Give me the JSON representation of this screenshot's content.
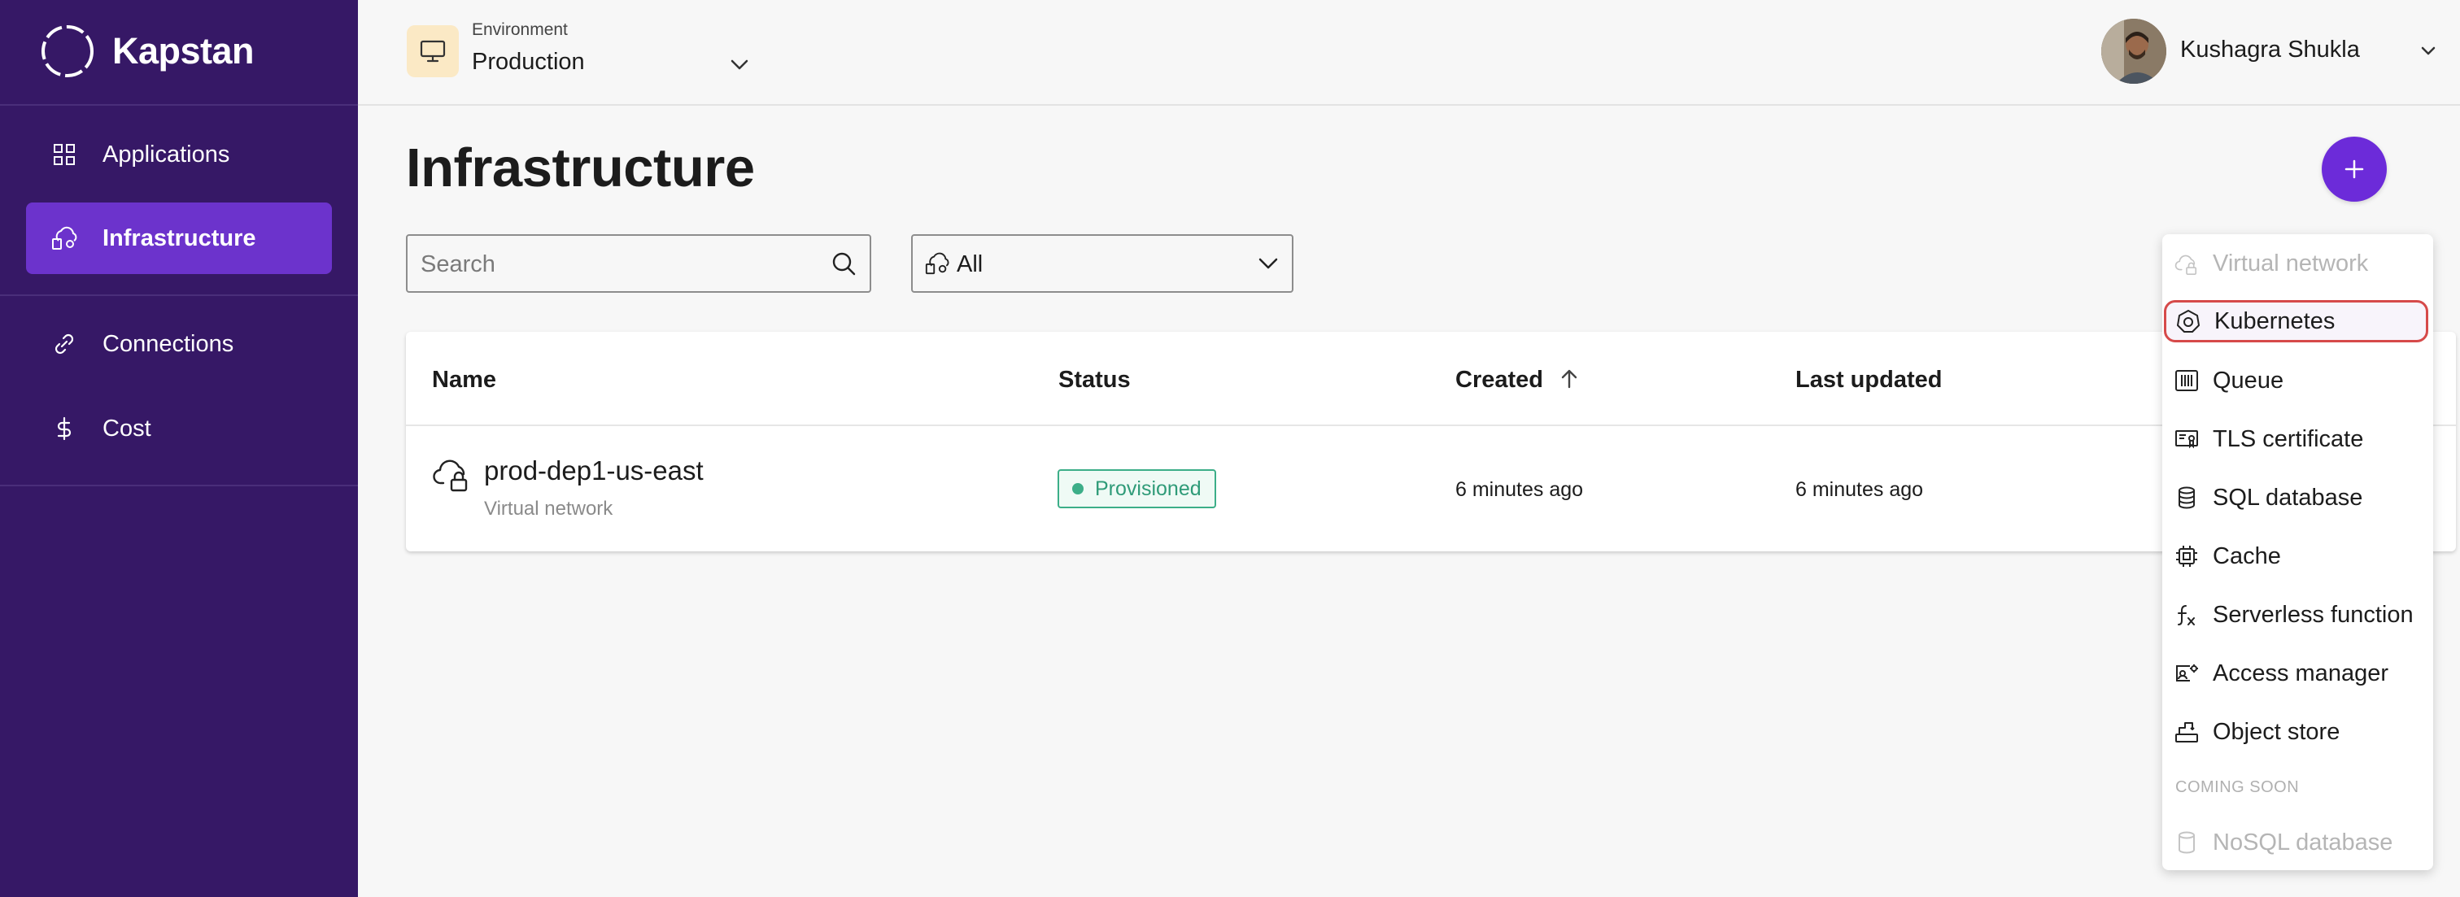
{
  "brand": {
    "name": "Kapstan"
  },
  "sidebar": {
    "items": [
      {
        "label": "Applications",
        "icon": "grid-icon"
      },
      {
        "label": "Infrastructure",
        "icon": "infrastructure-icon",
        "active": true
      },
      {
        "label": "Connections",
        "icon": "link-icon"
      },
      {
        "label": "Cost",
        "icon": "dollar-icon"
      }
    ]
  },
  "header": {
    "environment_caption": "Environment",
    "environment_value": "Production",
    "user_name": "Kushagra Shukla"
  },
  "main": {
    "title": "Infrastructure",
    "search": {
      "placeholder": "Search",
      "value": ""
    },
    "filter": {
      "value": "All"
    },
    "table": {
      "columns": [
        "Name",
        "Status",
        "Created",
        "Last updated"
      ],
      "rows": [
        {
          "name": "prod-dep1-us-east",
          "type": "Virtual network",
          "status": "Provisioned",
          "created": "6 minutes ago",
          "last_updated": "6 minutes ago"
        }
      ]
    }
  },
  "menu": {
    "items": [
      {
        "label": "Virtual network",
        "icon": "cloud-lock-icon",
        "disabled": true
      },
      {
        "label": "Kubernetes",
        "icon": "kubernetes-icon",
        "highlighted": true
      },
      {
        "label": "Queue",
        "icon": "queue-icon"
      },
      {
        "label": "TLS certificate",
        "icon": "certificate-icon"
      },
      {
        "label": "SQL database",
        "icon": "database-icon"
      },
      {
        "label": "Cache",
        "icon": "chip-icon"
      },
      {
        "label": "Serverless function",
        "icon": "function-icon"
      },
      {
        "label": "Access manager",
        "icon": "access-manager-icon"
      },
      {
        "label": "Object store",
        "icon": "object-store-icon"
      }
    ],
    "coming_soon_label": "COMING SOON",
    "coming_soon_items": [
      {
        "label": "NoSQL database",
        "icon": "nosql-database-icon",
        "disabled": true
      }
    ]
  },
  "colors": {
    "sidebar_bg": "#361866",
    "sidebar_active": "#6c33cc",
    "accent": "#6c2bd9",
    "status_green": "#3cae88",
    "highlight_border": "#d64a4a"
  }
}
